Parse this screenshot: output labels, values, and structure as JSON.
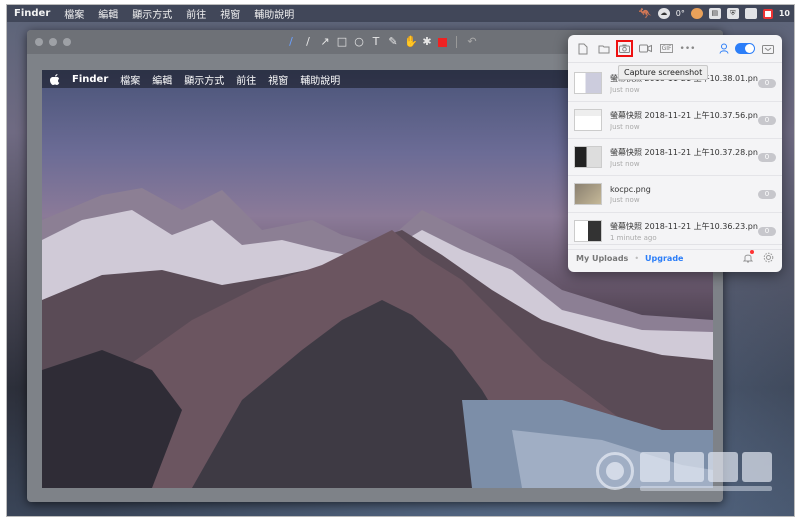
{
  "menubar": {
    "app": "Finder",
    "items": [
      "檔案",
      "編輯",
      "顯示方式",
      "前往",
      "視窗",
      "輔助說明"
    ],
    "status_temp": "0°",
    "status_right": "10"
  },
  "inner_menubar": {
    "app": "Finder",
    "items": [
      "檔案",
      "編輯",
      "顯示方式",
      "前往",
      "視窗",
      "輔助說明"
    ]
  },
  "editor": {
    "tools": [
      {
        "name": "pen-tool-icon",
        "glyph": "/"
      },
      {
        "name": "line-tool-icon",
        "glyph": "/"
      },
      {
        "name": "arrow-tool-icon",
        "glyph": "↗"
      },
      {
        "name": "rectangle-tool-icon",
        "glyph": "□"
      },
      {
        "name": "ellipse-tool-icon",
        "glyph": "○"
      },
      {
        "name": "text-tool-icon",
        "glyph": "T"
      },
      {
        "name": "brush-tool-icon",
        "glyph": "✎"
      },
      {
        "name": "hand-tool-icon",
        "glyph": "✋"
      },
      {
        "name": "pixelate-tool-icon",
        "glyph": "✱"
      }
    ],
    "color": "#e22222",
    "undo_glyph": "↶"
  },
  "popover": {
    "tooltip": "Capture screenshot",
    "files": [
      {
        "name": "螢幕快照 2018-11-21 上午10.38.01.png",
        "time": "Just now",
        "count": "0"
      },
      {
        "name": "螢幕快照 2018-11-21 上午10.37.56.png",
        "time": "Just now",
        "count": "0"
      },
      {
        "name": "螢幕快照 2018-11-21 上午10.37.28.png",
        "time": "Just now",
        "count": "0"
      },
      {
        "name": "kocpc.png",
        "time": "Just now",
        "count": "0"
      },
      {
        "name": "螢幕快照 2018-11-21 上午10.36.23.png",
        "time": "1 minute ago",
        "count": "0"
      }
    ],
    "footer": {
      "my_uploads": "My Uploads",
      "separator": "•",
      "upgrade": "Upgrade"
    },
    "accent": "#2c7ef8"
  }
}
